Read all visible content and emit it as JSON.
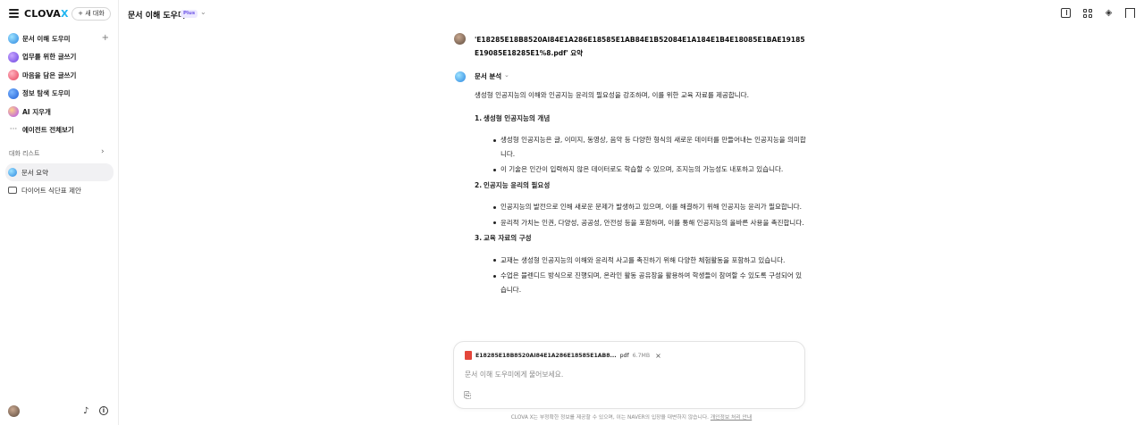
{
  "sidebar": {
    "logo_main": "CLOVA",
    "logo_x": "X",
    "new_chat_label": "+ 새 대화",
    "items": [
      {
        "label": "문서 이해 도우미",
        "icon": "document-assistant-icon",
        "add": "+"
      },
      {
        "label": "업무를 위한 글쓰기",
        "icon": "work-writing-icon"
      },
      {
        "label": "마음을 담은 글쓰기",
        "icon": "heart-writing-icon"
      },
      {
        "label": "정보 탐색 도우미",
        "icon": "info-search-icon"
      },
      {
        "label": "AI 지우개",
        "icon": "ai-eraser-icon"
      },
      {
        "label": "에이전트 전체보기",
        "icon": "more-icon",
        "glyph": "···"
      }
    ],
    "conversation_section_label": "대화 리스트",
    "conversations": [
      {
        "label": "문서 요약",
        "active": true
      },
      {
        "label": "다이어트 식단표 제안",
        "active": false
      }
    ]
  },
  "header": {
    "title": "문서 이해 도우미",
    "badge": "Plus"
  },
  "chat": {
    "user_message": "'E18285E18B8520AI84E1A286E18585E1AB84E1B52084E1A184E1B4E18085E1BAE19185E19085E18285E1%8.pdf' 요약",
    "bot_name": "문서 분석",
    "intro": "생성형 인공지능의 이해와 인공지능 윤리의 필요성을 강조하며, 이를 위한 교육 자료를 제공합니다.",
    "sections": [
      {
        "num": "1.",
        "title": "생성형 인공지능의 개념",
        "bullets": [
          "생성형 인공지능은 글, 이미지, 동영상, 음악 등 다양한 형식의 새로운 데이터를 만들어내는 인공지능을 의미합니다.",
          "이 기술은 인간이 입력하지 않은 데이터로도 학습할 수 있으며, 조지능의 가능성도 내포하고 있습니다."
        ]
      },
      {
        "num": "2.",
        "title": "인공지능 윤리의 필요성",
        "bullets": [
          "인공지능의 발전으로 인해 새로운 문제가 발생하고 있으며, 이를 해결하기 위해 인공지능 윤리가 필요합니다.",
          "윤리적 가치는 인권, 다양성, 공공성, 안전성 등을 포함하며, 이를 통해 인공지능의 올바른 사용을 촉진합니다."
        ]
      },
      {
        "num": "3.",
        "title": "교육 자료의 구성",
        "bullets": [
          "교재는 생성형 인공지능의 이해와 윤리적 사고를 촉진하기 위해 다양한 체험활동을 포함하고 있습니다.",
          "수업은 블렌디드 방식으로 진행되며, 온라인 활동 공유장을 활용하여 학생들이 참여할 수 있도록 구성되어 있습니다."
        ]
      }
    ]
  },
  "composer": {
    "file_name": "E18285E18B8520AI84E1A286E18585E1AB8...",
    "file_ext": "pdf",
    "file_size": "6.7MB",
    "placeholder": "문서 이해 도우미에게 물어보세요."
  },
  "footer": {
    "text": "CLOVA X는 부정확한 정보를 제공할 수 있으며, 이는 NAVER의 입장을 대변하지 않습니다.",
    "link": "개인정보 처리 안내"
  },
  "colors": {
    "accent": "#1fb5f0",
    "badge_bg": "#ece8ff",
    "badge_text": "#6d55e6",
    "pdf_red": "#e4463b"
  }
}
